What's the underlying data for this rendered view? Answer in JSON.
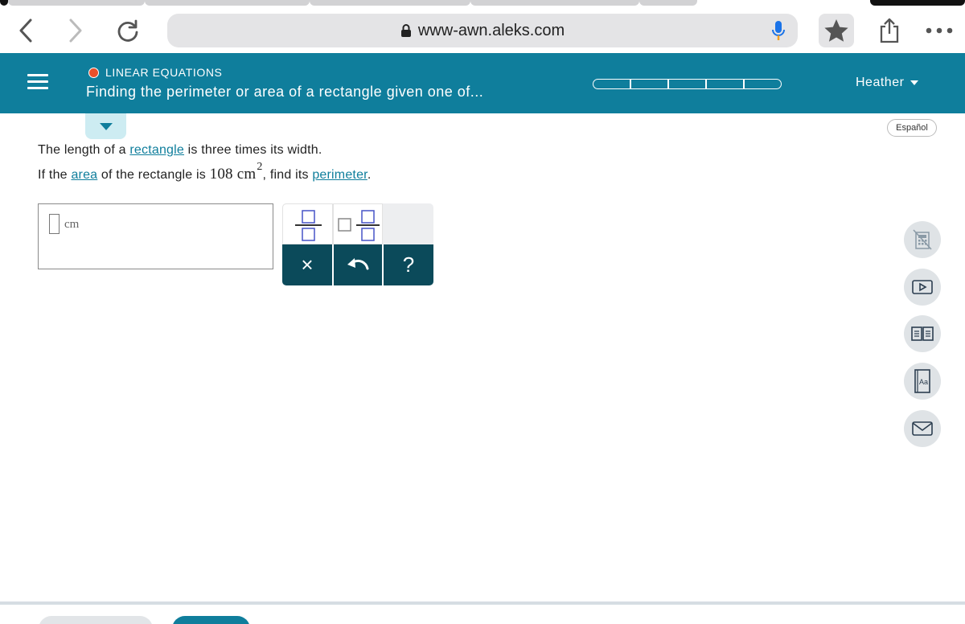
{
  "browser": {
    "url": "www-awn.aleks.com",
    "icons": {
      "back": "chevron-left-icon",
      "forward": "chevron-right-icon",
      "reload": "reload-icon",
      "lock": "lock-icon",
      "mic": "microphone-icon",
      "bookmark": "star-icon",
      "share": "share-icon",
      "more": "more-dots-icon"
    },
    "colors": {
      "mic_blue": "#1a73e8",
      "mic_orange": "#f4a020"
    }
  },
  "header": {
    "topic": "LINEAR EQUATIONS",
    "lesson_title": "Finding the perimeter or area of a rectangle given one of...",
    "user_name": "Heather",
    "progress_segments": 5,
    "colors": {
      "bar": "#0f7e9c",
      "topic_dot": "#e8502b"
    }
  },
  "language_toggle": "Español",
  "problem": {
    "line1": {
      "t1": "The length of a ",
      "link1": "rectangle",
      "t2": " is three times its width."
    },
    "line2": {
      "t1": "If the ",
      "link1": "area",
      "t2": " of the rectangle is ",
      "value": "108",
      "unit": "cm",
      "exp": "2",
      "t3": ", find its ",
      "link2": "perimeter",
      "t4": "."
    }
  },
  "answer": {
    "value": "",
    "unit": "cm"
  },
  "keypad": {
    "keys_top": [
      "fraction-key",
      "mixed-number-key"
    ],
    "keys_bottom": {
      "clear": "×",
      "undo": "undo-icon",
      "help": "?"
    }
  },
  "side_tools": [
    "calculator-icon",
    "video-icon",
    "textbook-icon",
    "dictionary-icon",
    "message-icon"
  ]
}
